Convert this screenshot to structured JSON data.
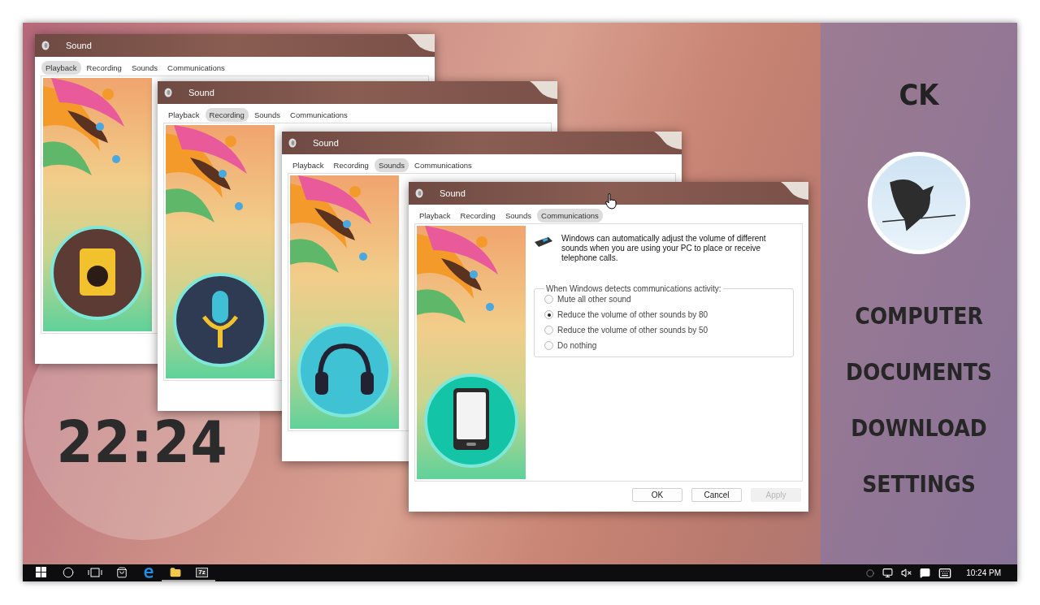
{
  "desktop": {
    "clock": "22:24"
  },
  "windows": [
    {
      "title": "Sound",
      "kind": "speaker",
      "tabs": [
        {
          "label": "Playback",
          "selected": true
        },
        {
          "label": "Recording",
          "selected": false
        },
        {
          "label": "Sounds",
          "selected": false
        },
        {
          "label": "Communications",
          "selected": false
        }
      ]
    },
    {
      "title": "Sound",
      "kind": "microphone",
      "tabs": [
        {
          "label": "Playback",
          "selected": false
        },
        {
          "label": "Recording",
          "selected": true
        },
        {
          "label": "Sounds",
          "selected": false
        },
        {
          "label": "Communications",
          "selected": false
        }
      ]
    },
    {
      "title": "Sound",
      "kind": "headphones",
      "tabs": [
        {
          "label": "Playback",
          "selected": false
        },
        {
          "label": "Recording",
          "selected": false
        },
        {
          "label": "Sounds",
          "selected": true
        },
        {
          "label": "Communications",
          "selected": false
        }
      ]
    },
    {
      "title": "Sound",
      "kind": "tablet",
      "tabs": [
        {
          "label": "Playback",
          "selected": false
        },
        {
          "label": "Recording",
          "selected": false
        },
        {
          "label": "Sounds",
          "selected": false
        },
        {
          "label": "Communications",
          "selected": true
        }
      ],
      "message": "Windows can automatically adjust the volume of different sounds when you are using your PC to place or receive telephone calls.",
      "group_label": "When Windows detects communications activity:",
      "options": [
        {
          "label": "Mute all other sound",
          "selected": false
        },
        {
          "label": "Reduce the volume of other sounds by 80",
          "selected": true
        },
        {
          "label": "Reduce the volume of other sounds by 50",
          "selected": false
        },
        {
          "label": "Do nothing",
          "selected": false
        }
      ],
      "buttons": [
        {
          "label": "OK",
          "disabled": false
        },
        {
          "label": "Cancel",
          "disabled": false
        },
        {
          "label": "Apply",
          "disabled": true
        }
      ]
    }
  ],
  "sidebar": {
    "user_name": "CK",
    "items": [
      {
        "label": "COMPUTER"
      },
      {
        "label": "DOCUMENTS"
      },
      {
        "label": "DOWNLOAD"
      },
      {
        "label": "SETTINGS"
      }
    ]
  },
  "taskbar": {
    "apps": [
      {
        "kind": "start",
        "running": false
      },
      {
        "kind": "search",
        "running": false
      },
      {
        "kind": "task-view",
        "running": false
      },
      {
        "kind": "store",
        "running": false
      },
      {
        "kind": "edge",
        "running": false
      },
      {
        "kind": "explorer",
        "running": true
      },
      {
        "kind": "archive",
        "label": "7z",
        "running": true
      }
    ],
    "time": "10:24 PM"
  }
}
